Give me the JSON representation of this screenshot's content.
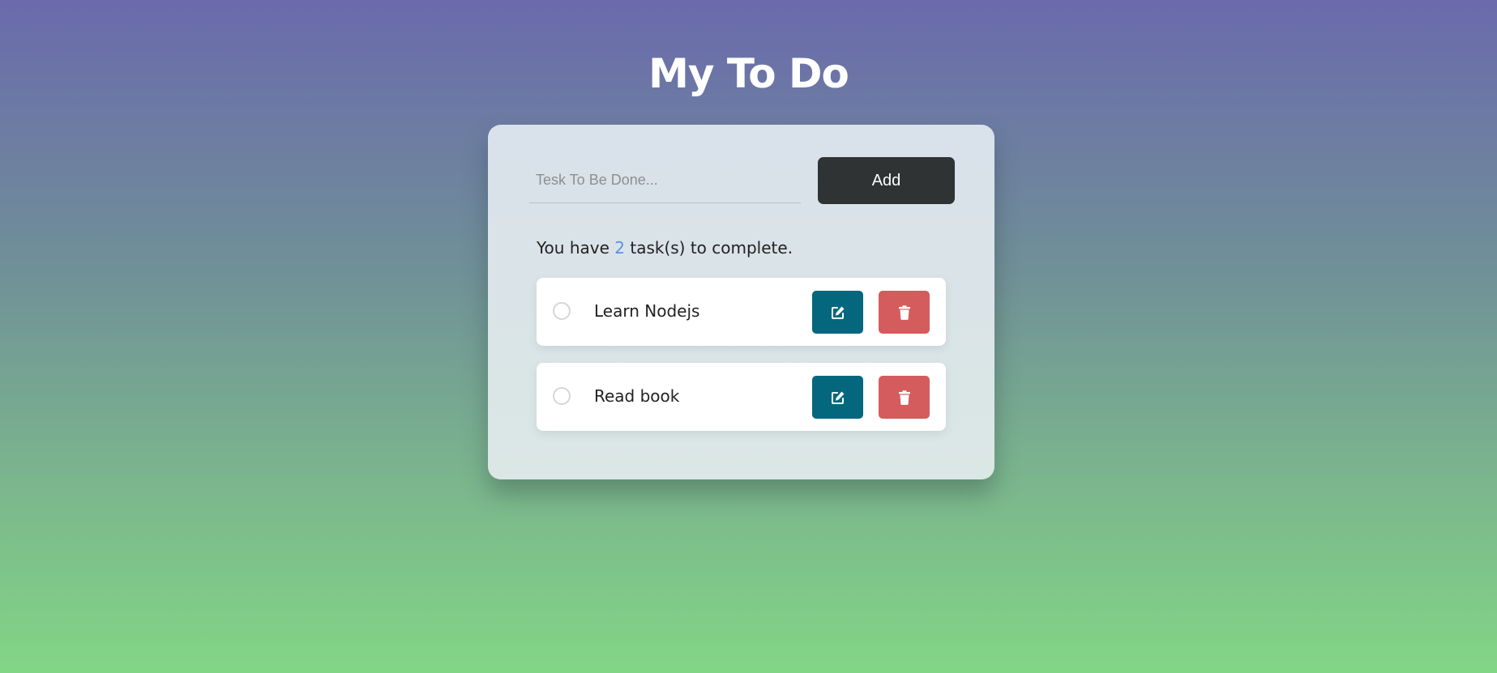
{
  "header": {
    "title": "My To Do"
  },
  "form": {
    "placeholder": "Tesk To Be Done...",
    "value": "",
    "add_label": "Add"
  },
  "summary": {
    "prefix": "You have ",
    "count": "2",
    "suffix": " task(s) to complete."
  },
  "tasks": [
    {
      "label": "Learn Nodejs",
      "completed": false
    },
    {
      "label": "Read book",
      "completed": false
    }
  ],
  "icons": {
    "check": "circle-outline",
    "edit": "edit-icon",
    "delete": "trash-icon"
  },
  "colors": {
    "add_button": "#2f3333",
    "edit_button": "#05677d",
    "delete_button": "#d55c5c",
    "count_accent": "#5b8ff0"
  }
}
